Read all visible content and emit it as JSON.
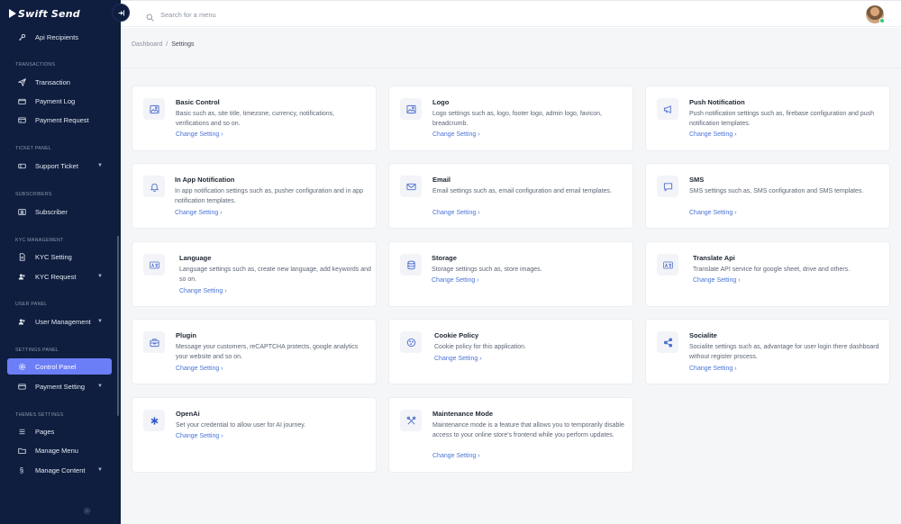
{
  "app": {
    "brand": "Swift Send"
  },
  "sidebar": {
    "top_item": "Api Recipients",
    "sections": {
      "transactions": "TRANSACTIONS",
      "ticket_panel": "TICKET PANEL",
      "subscribers": "SUBSCRIBERS",
      "kyc_management": "KYC MANAGEMENT",
      "user_panel": "USER PANEL",
      "settings_panel": "SETTINGS PANEL",
      "themes_settings": "THEMES SETTINGS"
    },
    "items": {
      "transaction": "Transaction",
      "payment_log": "Payment Log",
      "payment_request": "Payment Request",
      "support_ticket": "Support Ticket",
      "subscriber": "Subscriber",
      "kyc_setting": "KYC Setting",
      "kyc_request": "KYC Request",
      "user_management": "User Management",
      "control_panel": "Control Panel",
      "payment_setting": "Payment Setting",
      "pages": "Pages",
      "manage_menu": "Manage Menu",
      "manage_content": "Manage Content"
    },
    "active": "control_panel",
    "active_color": "#6b7ef7",
    "background_color": "#0f1e3f"
  },
  "topbar": {
    "search_placeholder": "Search for a menu"
  },
  "breadcrumb": {
    "parent": "Dashboard",
    "separator": "/",
    "current": "Settings"
  },
  "link_color": "#4a74d6",
  "cards": [
    {
      "icon": "image-icon",
      "title": "Basic Control",
      "description": "Basic such as, site title, timezone, currency, notifications, verifications and so on.",
      "link": "Change Setting ›"
    },
    {
      "icon": "image-icon",
      "title": "Logo",
      "description": "Logo settings such as, logo, footer logo, admin logo, favicon, breadcrumb.",
      "link": "Change Setting ›"
    },
    {
      "icon": "megaphone-icon",
      "title": "Push Notification",
      "description": "Push notification settings such as, firebase configuration and push notification templates.",
      "link": "Change Setting ›"
    },
    {
      "icon": "bell-icon",
      "title": "In App Notification",
      "description": "In app notification settings such as, pusher configuration and in app notification templates.",
      "link": "Change Setting ›"
    },
    {
      "icon": "envelope-icon",
      "title": "Email",
      "description": "Email settings such as, email configuration and email templates.",
      "link": "Change Setting ›"
    },
    {
      "icon": "chat-icon",
      "title": "SMS",
      "description": "SMS settings such as, SMS configuration and SMS templates.",
      "link": "Change Setting ›"
    },
    {
      "icon": "translate-icon",
      "title": "Language",
      "description": "Language settings such as, create new language, add keywords and so on.",
      "link": "Change Setting ›"
    },
    {
      "icon": "database-icon",
      "title": "Storage",
      "description": "Storage settings such as, store images.",
      "link": "Change Setting ›"
    },
    {
      "icon": "translate-icon",
      "title": "Translate Api",
      "description": "Translate API service for google sheet, drive and others.",
      "link": "Change Setting ›"
    },
    {
      "icon": "toolbox-icon",
      "title": "Plugin",
      "description": "Message your customers, reCAPTCHA protects, google analytics your website and so on.",
      "link": "Change Setting ›"
    },
    {
      "icon": "cookie-icon",
      "title": "Cookie Policy",
      "description": "Cookie policy for this application.",
      "link": "Change Setting ›"
    },
    {
      "icon": "share-icon",
      "title": "Socialite",
      "description": "Socialite settings such as, advantage for user login there dashboard without register process.",
      "link": "Change Setting ›"
    },
    {
      "icon": "asterisk-icon",
      "title": "OpenAi",
      "description": "Set your credential to allow user for AI journey.",
      "link": "Change Setting ›"
    },
    {
      "icon": "tools-icon",
      "title": "Maintenance Mode",
      "description": "Maintenance mode is a feature that allows you to temporarily disable access to your online store's frontend while you perform updates.",
      "link": "Change Setting ›"
    }
  ]
}
